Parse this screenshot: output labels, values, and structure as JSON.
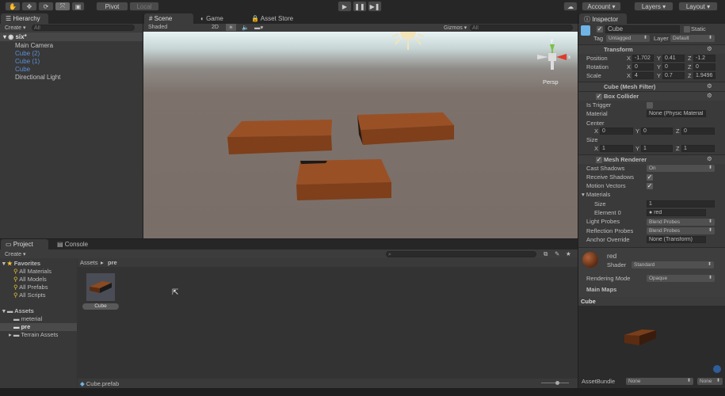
{
  "toolbar": {
    "pivot": "Pivot",
    "local": "Local",
    "account": "Account",
    "layers": "Layers",
    "layout": "Layout"
  },
  "hierarchy": {
    "tab": "Hierarchy",
    "create": "Create",
    "search_placeholder": "All",
    "scene": "six*",
    "items": [
      {
        "label": "Main Camera",
        "prefab": false
      },
      {
        "label": "Cube (2)",
        "prefab": true
      },
      {
        "label": "Cube (1)",
        "prefab": true
      },
      {
        "label": "Cube",
        "prefab": true
      },
      {
        "label": "Directional Light",
        "prefab": false
      }
    ]
  },
  "scene": {
    "tabs": [
      "Scene",
      "Game",
      "Asset Store"
    ],
    "shading": "Shaded",
    "mode2d": "2D",
    "gizmos": "Gizmos",
    "search_placeholder": "All",
    "persp": "Persp",
    "axis_x": "x",
    "axis_y": "y"
  },
  "inspector": {
    "tab": "Inspector",
    "object_name": "Cube",
    "static": "Static",
    "tag_label": "Tag",
    "tag": "Untagged",
    "layer_label": "Layer",
    "layer": "Default",
    "transform": {
      "title": "Transform",
      "rows": [
        {
          "label": "Position",
          "x": "-1.702",
          "y": "0.41",
          "z": "-1.2"
        },
        {
          "label": "Rotation",
          "x": "0",
          "y": "0",
          "z": "0"
        },
        {
          "label": "Scale",
          "x": "4",
          "y": "0.7",
          "z": "1.9496"
        }
      ]
    },
    "mesh_filter": "Cube (Mesh Filter)",
    "box_collider": {
      "title": "Box Collider",
      "is_trigger": "Is Trigger",
      "material_label": "Material",
      "material": "None (Physic Material",
      "center": "Center",
      "center_xyz": [
        "0",
        "0",
        "0"
      ],
      "size": "Size",
      "size_xyz": [
        "1",
        "1",
        "1"
      ]
    },
    "mesh_renderer": {
      "title": "Mesh Renderer",
      "cast_shadows": "Cast Shadows",
      "cast_value": "On",
      "receive_shadows": "Receive Shadows",
      "motion_vectors": "Motion Vectors",
      "materials": "Materials",
      "size_label": "Size",
      "size": "1",
      "element0_label": "Element 0",
      "element0": "red",
      "light_probes": "Light Probes",
      "light_value": "Blend Probes",
      "reflection_probes": "Reflection Probes",
      "reflection_value": "Blend Probes",
      "anchor_override": "Anchor Override",
      "anchor_value": "None (Transform)"
    },
    "material": {
      "name": "red",
      "shader_label": "Shader",
      "shader": "Standard",
      "rendering_mode": "Rendering Mode",
      "rendering_value": "Opaque",
      "main_maps": "Main Maps"
    },
    "preview": {
      "title": "Cube",
      "assetbundle": "AssetBundle",
      "bundle1": "None",
      "bundle2": "None"
    }
  },
  "project": {
    "tabs": [
      "Project",
      "Console"
    ],
    "create": "Create",
    "favorites": "Favorites",
    "fav_items": [
      "All Materials",
      "All Models",
      "All Prefabs",
      "All Scripts"
    ],
    "assets": "Assets",
    "folders": [
      "meterial",
      "pre",
      "Terrain Assets"
    ],
    "breadcrumb": [
      "Assets",
      "pre"
    ],
    "asset_label": "Cube",
    "selected_path": "Cube.prefab"
  },
  "colors": {
    "bg": "#383838",
    "prefab_blue": "#5b8fd6",
    "cube": "#8a4a22"
  }
}
